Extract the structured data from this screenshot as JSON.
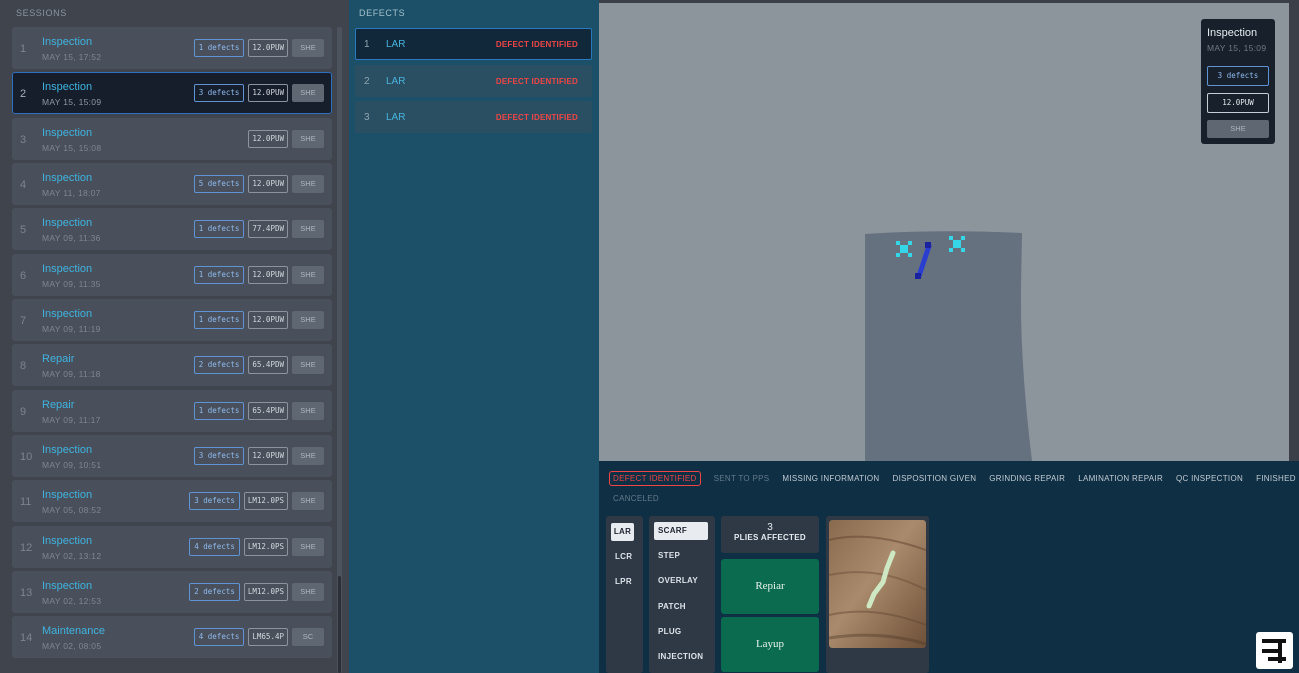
{
  "sessions": {
    "title": "SESSIONS",
    "items": [
      {
        "index": "1",
        "name": "Inspection",
        "date": "MAY 15, 17:52",
        "defects": "1 defects",
        "code": "12.0PUW",
        "type": "SHE"
      },
      {
        "index": "2",
        "name": "Inspection",
        "date": "MAY 15, 15:09",
        "defects": "3 defects",
        "code": "12.0PUW",
        "type": "SHE"
      },
      {
        "index": "3",
        "name": "Inspection",
        "date": "MAY 15, 15:08",
        "defects": "",
        "code": "12.0PUW",
        "type": "SHE"
      },
      {
        "index": "4",
        "name": "Inspection",
        "date": "MAY 11, 18:07",
        "defects": "5 defects",
        "code": "12.0PUW",
        "type": "SHE"
      },
      {
        "index": "5",
        "name": "Inspection",
        "date": "MAY 09, 11:36",
        "defects": "1 defects",
        "code": "77.4PDW",
        "type": "SHE"
      },
      {
        "index": "6",
        "name": "Inspection",
        "date": "MAY 09, 11:35",
        "defects": "1 defects",
        "code": "12.0PUW",
        "type": "SHE"
      },
      {
        "index": "7",
        "name": "Inspection",
        "date": "MAY 09, 11:19",
        "defects": "1 defects",
        "code": "12.0PUW",
        "type": "SHE"
      },
      {
        "index": "8",
        "name": "Repair",
        "date": "MAY 09, 11:18",
        "defects": "2 defects",
        "code": "65.4PDW",
        "type": "SHE"
      },
      {
        "index": "9",
        "name": "Repair",
        "date": "MAY 09, 11:17",
        "defects": "1 defects",
        "code": "65.4PUW",
        "type": "SHE"
      },
      {
        "index": "10",
        "name": "Inspection",
        "date": "MAY 09, 10:51",
        "defects": "3 defects",
        "code": "12.0PUW",
        "type": "SHE"
      },
      {
        "index": "11",
        "name": "Inspection",
        "date": "MAY 05, 08:52",
        "defects": "3 defects",
        "code": "LM12.0PS",
        "type": "SHE"
      },
      {
        "index": "12",
        "name": "Inspection",
        "date": "MAY 02, 13:12",
        "defects": "4 defects",
        "code": "LM12.0PS",
        "type": "SHE"
      },
      {
        "index": "13",
        "name": "Inspection",
        "date": "MAY 02, 12:53",
        "defects": "2 defects",
        "code": "LM12.0PS",
        "type": "SHE"
      },
      {
        "index": "14",
        "name": "Maintenance",
        "date": "MAY 02, 08:05",
        "defects": "4 defects",
        "code": "LM65.4P",
        "type": "SC"
      }
    ]
  },
  "defects": {
    "title": "DEFECTS",
    "items": [
      {
        "index": "1",
        "name": "LAR",
        "status": "DEFECT IDENTIFIED"
      },
      {
        "index": "2",
        "name": "LAR",
        "status": "DEFECT IDENTIFIED"
      },
      {
        "index": "3",
        "name": "LAR",
        "status": "DEFECT IDENTIFIED"
      }
    ]
  },
  "viewer": {
    "card": {
      "name": "Inspection",
      "date": "MAY 15, 15:09",
      "defects": "3 defects",
      "code": "12.0PUW",
      "type": "SHE"
    }
  },
  "status_steps": [
    "DEFECT IDENTIFIED",
    "SENT TO PPS",
    "MISSING INFORMATION",
    "DISPOSITION GIVEN",
    "GRINDING REPAIR",
    "LAMINATION REPAIR",
    "QC INSPECTION",
    "FINISHED",
    "CANCELED"
  ],
  "active_status": "DEFECT IDENTIFIED",
  "defect_types": [
    "LAR",
    "LCR",
    "LPR"
  ],
  "selected_defect_type": "LAR",
  "repair_methods": [
    "SCARF",
    "STEP",
    "OVERLAY",
    "PATCH",
    "PLUG",
    "INJECTION"
  ],
  "selected_repair_method": "SCARF",
  "plies": {
    "count": "3",
    "label": "PLIES AFFECTED"
  },
  "actions": {
    "repair_label": "Repiar",
    "layup_label": "Layup"
  },
  "colors": {
    "accent": "#3fb3e0",
    "status_red": "#f04545",
    "action_green": "#0b6b4f",
    "marker_cyan": "#35d6e8",
    "marker_blue": "#2a3fd0"
  },
  "icons": {
    "logo": "brand-logo-icon",
    "defect_marker": "crosshair-marker-icon",
    "defect_line": "line-defect-icon"
  }
}
